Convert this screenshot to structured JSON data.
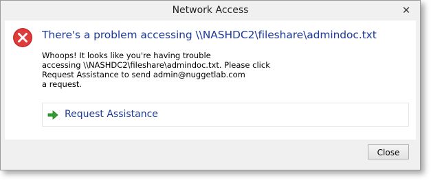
{
  "window": {
    "title": "Network Access",
    "close_glyph": "✕"
  },
  "dialog": {
    "icon": "error-icon",
    "heading": "There's a problem accessing \\\\NASHDC2\\fileshare\\admindoc.txt",
    "message_lines": [
      "Whoops! It looks like you're having trouble",
      "accessing \\\\NASHDC2\\fileshare\\admindoc.txt. Please click",
      "Request Assistance to send admin@nuggetlab.com",
      "a request."
    ],
    "request_link": {
      "icon": "green-arrow-icon",
      "label": "Request Assistance"
    }
  },
  "footer": {
    "close_label": "Close"
  },
  "colors": {
    "heading": "#1c3a9a",
    "error_red": "#d42a2a",
    "arrow_green": "#2e9e2e"
  }
}
